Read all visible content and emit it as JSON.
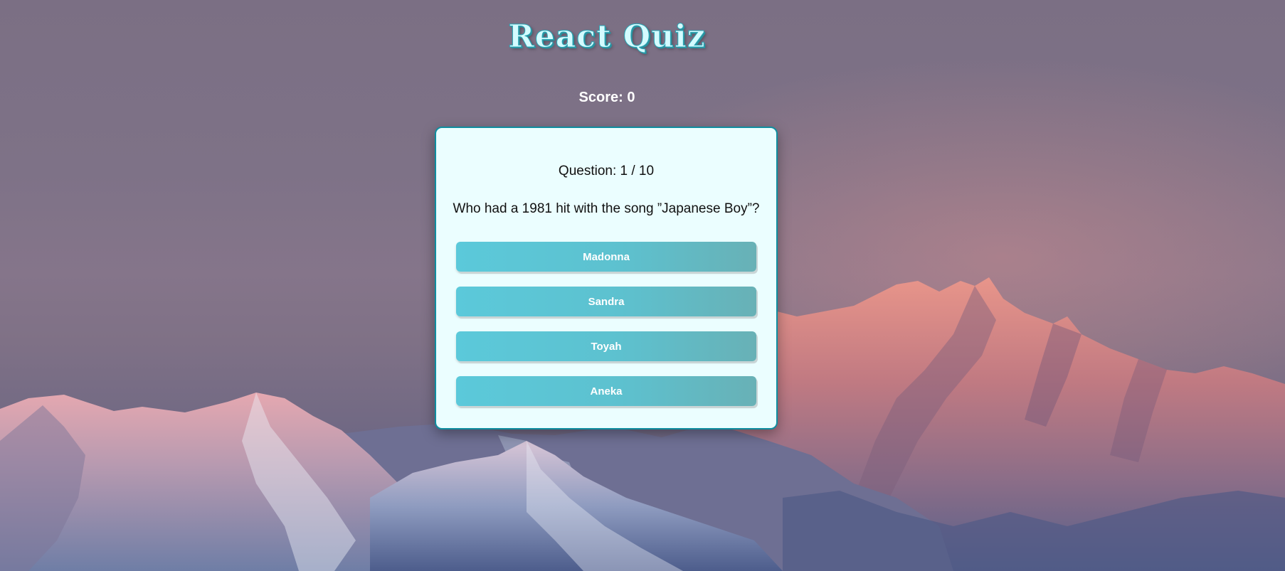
{
  "header": {
    "title": "React Quiz"
  },
  "score": {
    "label": "Score: 0"
  },
  "quiz": {
    "question_number": "Question: 1 / 10",
    "question": "Who had a 1981 hit with the song ”Japanese Boy”?",
    "answers": [
      {
        "label": "Madonna"
      },
      {
        "label": "Sandra"
      },
      {
        "label": "Toyah"
      },
      {
        "label": "Aneka"
      }
    ]
  },
  "colors": {
    "card_background": "#ebfeff",
    "card_border": "#0f8ea0",
    "button_start": "#5bc9da",
    "button_end": "#68b1b6",
    "title_fill": "#d4fbff"
  }
}
